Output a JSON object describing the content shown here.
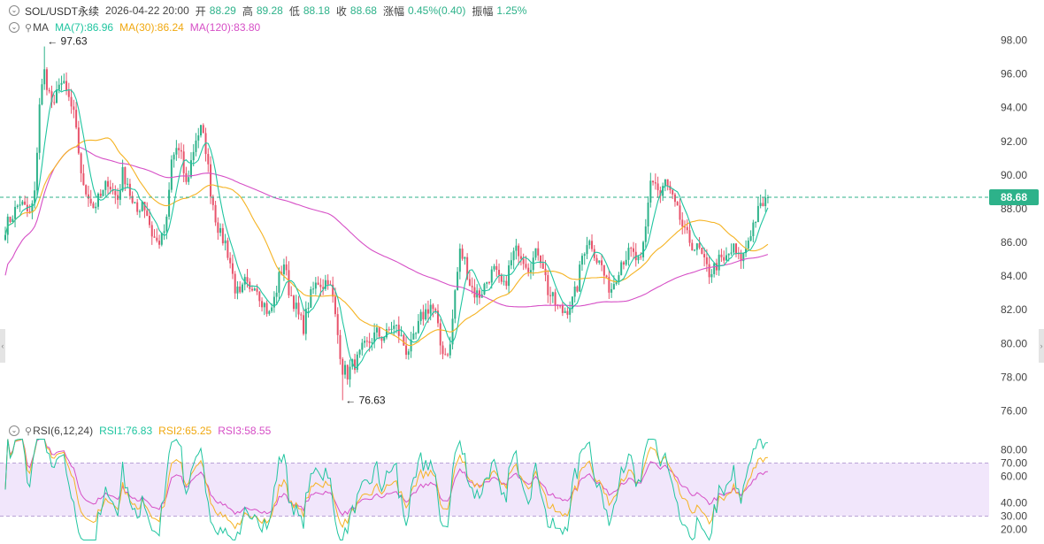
{
  "ohlc_header": {
    "symbol": "SOL/USDT永续",
    "datetime": "2026-04-22 20:00",
    "open_label": "开",
    "open_value": "88.29",
    "high_label": "高",
    "high_value": "89.28",
    "low_label": "低",
    "low_value": "88.18",
    "close_label": "收",
    "close_value": "88.68",
    "change_label": "涨幅",
    "change_value": "0.45%(0.40)",
    "amplitude_label": "振幅",
    "amplitude_value": "1.25%"
  },
  "ma_header": {
    "name": "MA",
    "ma7": "MA(7):86.96",
    "ma30": "MA(30):86.24",
    "ma120": "MA(120):83.80"
  },
  "rsi_header": {
    "name": "RSI(6,12,24)",
    "rsi1": "RSI1:76.83",
    "rsi2": "RSI2:65.25",
    "rsi3": "RSI3:58.55"
  },
  "colors": {
    "up": "#2db28a",
    "down": "#e8536b",
    "ma7": "#20c5a0",
    "ma30": "#f5b323",
    "ma120": "#d64fc6",
    "rsi1": "#20c5a0",
    "rsi2": "#f5b323",
    "rsi3": "#d64fc6",
    "rsi_band": "#f1e6fb",
    "price_tag": "#2db28a"
  },
  "chart_data": [
    {
      "type": "candlestick",
      "title": "SOL/USDT永续",
      "interval_note": "hourly candles ending 2026-04-22 20:00",
      "y_ticks": [
        "98.00",
        "96.00",
        "94.00",
        "92.00",
        "90.00",
        "88.00",
        "86.00",
        "84.00",
        "82.00",
        "80.00",
        "78.00",
        "76.00"
      ],
      "ylim": [
        75.2,
        99.4
      ],
      "last_price": 88.68,
      "last_price_label": "88.68",
      "annotations": [
        {
          "text": "97.63",
          "price": 97.63,
          "kind": "high",
          "arrow": "←"
        },
        {
          "text": "76.63",
          "price": 76.63,
          "kind": "low",
          "arrow": "←"
        }
      ],
      "close_path": [
        86.9,
        87.4,
        87.9,
        88.4,
        88.0,
        87.6,
        88.8,
        94.3,
        96.1,
        94.8,
        93.9,
        95.7,
        95.2,
        94.5,
        93.5,
        91.4,
        89.1,
        88.9,
        88.1,
        88.5,
        88.9,
        89.7,
        89.0,
        88.6,
        90.1,
        89.6,
        88.2,
        87.8,
        88.5,
        87.7,
        86.5,
        86.0,
        86.2,
        87.2,
        90.8,
        91.6,
        91.0,
        89.4,
        90.8,
        92.2,
        92.7,
        91.6,
        89.1,
        87.5,
        86.4,
        86.0,
        84.8,
        83.3,
        82.7,
        83.6,
        83.0,
        83.7,
        82.9,
        82.3,
        81.7,
        82.6,
        83.9,
        84.8,
        83.2,
        82.5,
        81.6,
        81.0,
        82.4,
        83.2,
        83.7,
        83.5,
        83.9,
        82.6,
        80.5,
        78.5,
        78.2,
        78.7,
        79.0,
        79.6,
        79.9,
        80.3,
        80.6,
        80.4,
        80.5,
        81.0,
        80.9,
        80.3,
        79.6,
        79.8,
        80.5,
        81.5,
        81.9,
        82.3,
        81.7,
        79.9,
        79.4,
        79.8,
        83.1,
        85.4,
        84.9,
        83.6,
        83.0,
        82.9,
        83.4,
        84.0,
        84.3,
        83.7,
        83.3,
        84.4,
        85.3,
        85.6,
        85.1,
        84.6,
        85.0,
        85.5,
        84.7,
        83.1,
        82.6,
        82.1,
        81.9,
        82.1,
        82.5,
        83.4,
        85.2,
        86.1,
        85.9,
        85.0,
        84.6,
        83.5,
        83.3,
        84.1,
        84.9,
        85.2,
        85.4,
        85.0,
        84.7,
        86.8,
        89.8,
        89.5,
        88.7,
        89.6,
        88.9,
        88.1,
        87.4,
        86.5,
        86.1,
        85.7,
        85.5,
        84.7,
        84.2,
        84.5,
        84.9,
        84.8,
        85.3,
        85.6,
        85.0,
        85.2,
        86.2,
        87.1,
        87.8,
        88.3,
        88.68
      ],
      "high_point": {
        "index": 8,
        "price": 97.63
      },
      "low_point": {
        "index": 69,
        "price": 76.63
      },
      "ma_final": {
        "MA(7)": 86.96,
        "MA(30)": 86.24,
        "MA(120)": 83.8
      }
    },
    {
      "type": "line",
      "title": "RSI(6,12,24)",
      "y_ticks": [
        "80.00",
        "70.00",
        "60.00",
        "40.00",
        "30.00",
        "20.00"
      ],
      "ylim": [
        18,
        83
      ],
      "band": [
        30,
        70
      ],
      "series_final": {
        "RSI1": 76.83,
        "RSI2": 65.25,
        "RSI3": 58.55
      }
    }
  ]
}
